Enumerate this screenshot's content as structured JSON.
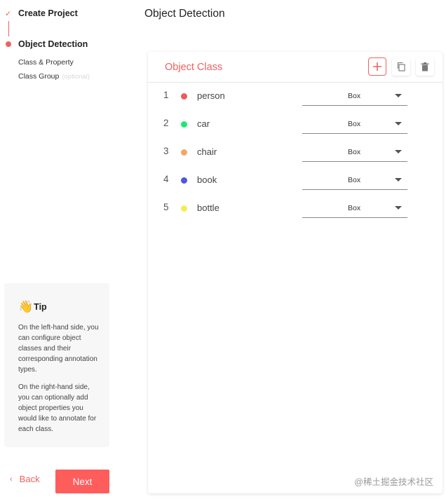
{
  "stepper": {
    "steps": [
      {
        "label": "Create Project",
        "status": "done"
      },
      {
        "label": "Object Detection",
        "status": "active"
      }
    ],
    "substeps": [
      {
        "label": "Class & Property"
      },
      {
        "label": "Class Group",
        "optional": "(optional)"
      }
    ]
  },
  "tip": {
    "icon": "👋",
    "title": "Tip",
    "p1": "On the left-hand side, you can configure object classes and their corresponding annotation types.",
    "p2": "On the right-hand side, you can optionally add object properties you would like to annotate for each class."
  },
  "footer": {
    "back_label": "Back",
    "next_label": "Next"
  },
  "main": {
    "title": "Object Detection",
    "card_title": "Object Class",
    "classes": [
      {
        "index": "1",
        "name": "person",
        "color": "#ee5a5a",
        "type": "Box"
      },
      {
        "index": "2",
        "name": "car",
        "color": "#1ee870",
        "type": "Box"
      },
      {
        "index": "3",
        "name": "chair",
        "color": "#f2a766",
        "type": "Box"
      },
      {
        "index": "4",
        "name": "book",
        "color": "#5056e0",
        "type": "Box"
      },
      {
        "index": "5",
        "name": "bottle",
        "color": "#f6ec4e",
        "type": "Box"
      }
    ]
  },
  "watermark": "@稀土掘金技术社区",
  "colors": {
    "accent": "#f06060",
    "next_button": "#ff5c5c"
  }
}
